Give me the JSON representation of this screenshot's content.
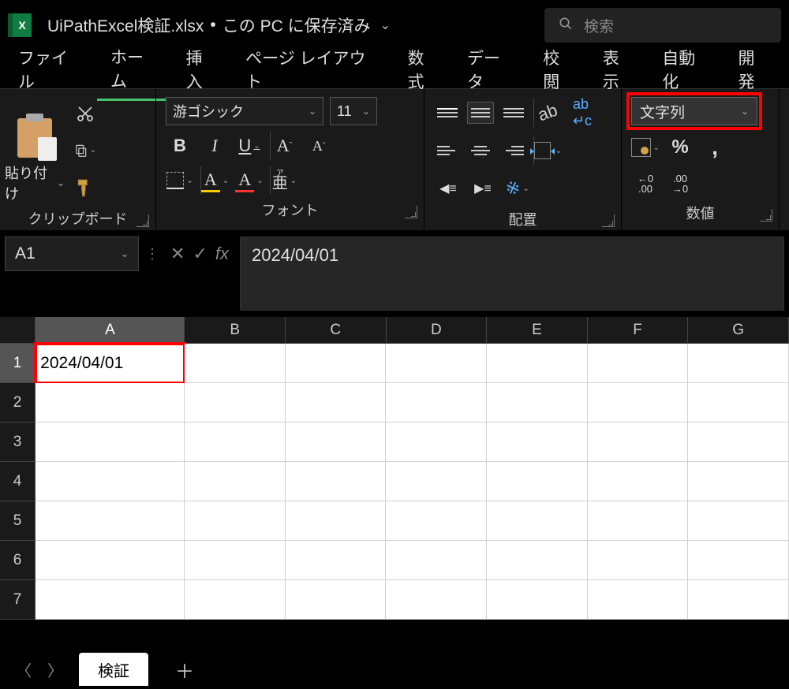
{
  "titlebar": {
    "filename": "UiPathExcel検証.xlsx",
    "save_status": "この PC に保存済み",
    "search_placeholder": "検索"
  },
  "ribbon_tabs": {
    "file": "ファイル",
    "home": "ホーム",
    "insert": "挿入",
    "page_layout": "ページ レイアウト",
    "formulas": "数式",
    "data": "データ",
    "review": "校閲",
    "view": "表示",
    "automate": "自動化",
    "developer": "開発"
  },
  "ribbon": {
    "clipboard": {
      "paste": "貼り付け",
      "label": "クリップボード"
    },
    "font": {
      "name": "游ゴシック",
      "size": "11",
      "bold": "B",
      "italic": "I",
      "underline": "U",
      "label": "フォント"
    },
    "alignment": {
      "label": "配置"
    },
    "number": {
      "format": "文字列",
      "label": "数値",
      "dec_inc": ".00",
      "dec_inc2": "→.0",
      "dec_dec": ".0",
      "dec_dec2": "→.00"
    }
  },
  "formula_bar": {
    "cell_ref": "A1",
    "formula": "2024/04/01"
  },
  "grid": {
    "columns": [
      "A",
      "B",
      "C",
      "D",
      "E",
      "F",
      "G"
    ],
    "rows": [
      "1",
      "2",
      "3",
      "4",
      "5",
      "6",
      "7"
    ],
    "a1_value": "2024/04/01"
  },
  "sheet": {
    "active_tab": "検証"
  }
}
